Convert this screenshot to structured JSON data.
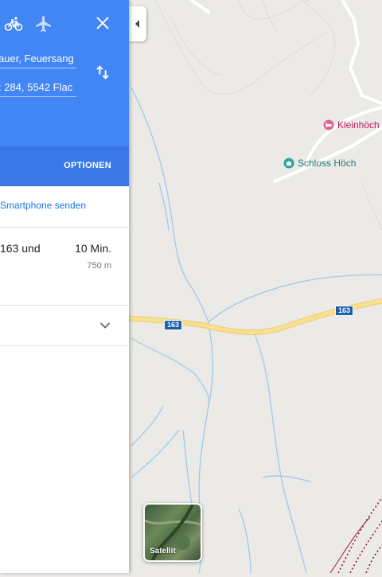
{
  "directions": {
    "travel_modes": [
      "bicycle-icon",
      "flight-icon"
    ],
    "start": "auer, Feuersang",
    "destination": ": 284, 5542 Flac",
    "options_label": "OPTIONEN",
    "send_to_phone": "Smartphone senden",
    "route": {
      "via": "163 und",
      "duration": "10 Min.",
      "distance": "750 m"
    }
  },
  "map": {
    "places": [
      {
        "name": "Kleinhöch",
        "icon": "hotel-icon",
        "color": "#c2185b"
      },
      {
        "name": "Schloss Höch",
        "icon": "castle-icon",
        "color": "#1e7b74"
      }
    ],
    "road_labels": [
      "163",
      "163"
    ],
    "layer_button": "Satellit"
  },
  "colors": {
    "header_blue": "#4285f4",
    "options_blue": "#3b78e7",
    "road_yellow": "#f8e08e",
    "water_blue": "#9cc9ef",
    "trail_red": "#8d1b3d"
  }
}
